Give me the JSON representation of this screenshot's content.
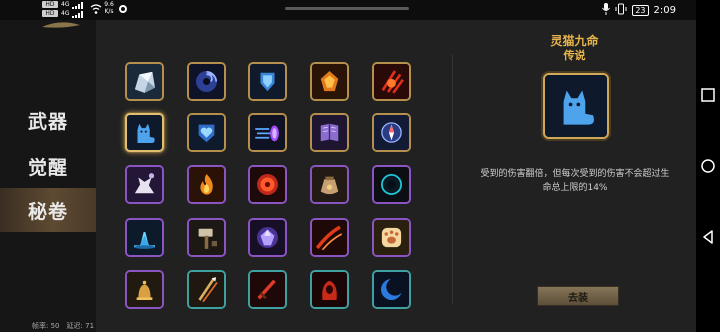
{
  "status_bar": {
    "hd1": "HD",
    "hd2": "HD",
    "net1": "4G",
    "net2": "4G",
    "speed_value": "9.6",
    "speed_unit": "K/s",
    "battery": "23",
    "time": "2:09",
    "icons": [
      "mic-icon",
      "vibrate-icon",
      "battery-icon"
    ]
  },
  "sidebar": {
    "tabs": [
      {
        "label": "武器",
        "active": false
      },
      {
        "label": "觉醒",
        "active": false
      },
      {
        "label": "秘卷",
        "active": true
      }
    ]
  },
  "footer": {
    "fps_label": "帧率:",
    "fps_value": "50",
    "latency_label": "延迟:",
    "latency_value": "71"
  },
  "grid": {
    "rows": [
      [
        {
          "icon": "ice-rock-icon",
          "frame": "gold"
        },
        {
          "icon": "vortex-icon",
          "frame": "gold"
        },
        {
          "icon": "blue-shield-icon",
          "frame": "gold"
        },
        {
          "icon": "fire-gem-icon",
          "frame": "gold"
        },
        {
          "icon": "red-claw-icon",
          "frame": "gold"
        }
      ],
      [
        {
          "icon": "cat-icon",
          "frame": "selected"
        },
        {
          "icon": "blue-heart-shield-icon",
          "frame": "gold"
        },
        {
          "icon": "blue-dash-icon",
          "frame": "gold"
        },
        {
          "icon": "spellbook-icon",
          "frame": "gold"
        },
        {
          "icon": "compass-icon",
          "frame": "gold"
        }
      ],
      [
        {
          "icon": "howling-wolf-icon",
          "frame": "purple"
        },
        {
          "icon": "flame-icon",
          "frame": "purple"
        },
        {
          "icon": "red-orb-icon",
          "frame": "purple"
        },
        {
          "icon": "sack-icon",
          "frame": "purple"
        },
        {
          "icon": "dark-orb-icon",
          "frame": "purple"
        }
      ],
      [
        {
          "icon": "ice-spike-icon",
          "frame": "purple"
        },
        {
          "icon": "hammer-icon",
          "frame": "purple"
        },
        {
          "icon": "purple-gem-icon",
          "frame": "purple"
        },
        {
          "icon": "red-slash-icon",
          "frame": "purple"
        },
        {
          "icon": "paw-icon",
          "frame": "purple"
        }
      ],
      [
        {
          "icon": "golden-bell-icon",
          "frame": "purple"
        },
        {
          "icon": "arrow-quiver-icon",
          "frame": "teal"
        },
        {
          "icon": "red-sword-icon",
          "frame": "teal"
        },
        {
          "icon": "red-hood-icon",
          "frame": "teal"
        },
        {
          "icon": "blue-crescent-icon",
          "frame": "teal"
        }
      ]
    ]
  },
  "detail": {
    "name": "灵猫九命",
    "rarity": "传说",
    "icon": "cat-icon",
    "description": "受到的伤害翻倍，但每次受到的伤害不会超过生命总上限的14%",
    "equip_label": "去装"
  },
  "nav_bar": {
    "buttons": [
      "recent-apps-icon",
      "home-icon",
      "back-icon"
    ]
  },
  "colors": {
    "accent_gold": "#e8b54a",
    "frame_gold": "#b4904c",
    "frame_purple": "#8a55c2",
    "frame_teal": "#3fa0a0"
  }
}
